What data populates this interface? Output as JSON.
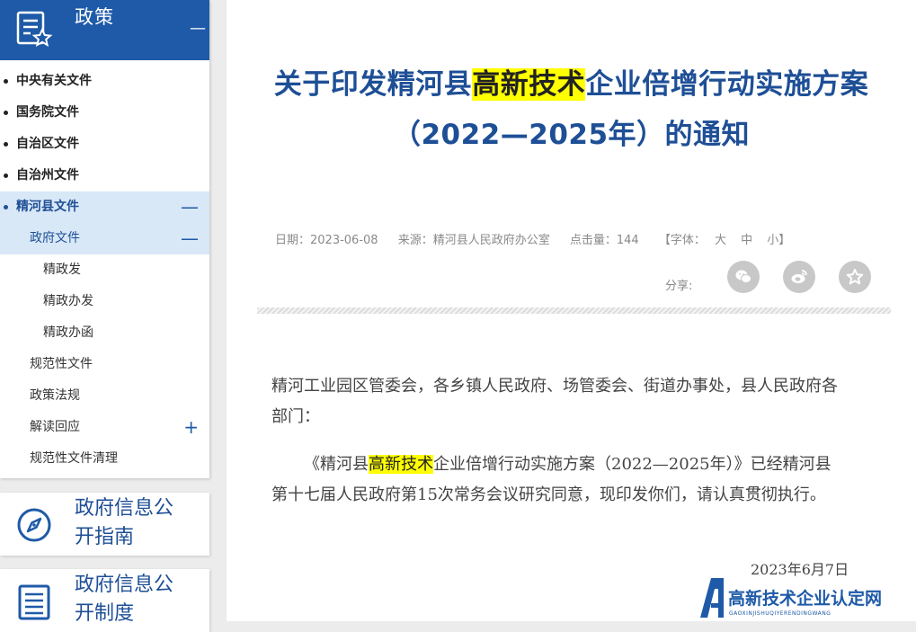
{
  "sidebar": {
    "policy_title": "政策",
    "collapse_symbol": "—",
    "menu": [
      {
        "label": "中央有关文件"
      },
      {
        "label": "国务院文件"
      },
      {
        "label": "自治区文件"
      },
      {
        "label": "自治州文件"
      },
      {
        "label": "精河县文件",
        "toggle": "—"
      },
      {
        "label": "政府文件",
        "toggle": "—"
      },
      {
        "label": "精政发"
      },
      {
        "label": "精政办发"
      },
      {
        "label": "精政办函"
      },
      {
        "label": "规范性文件"
      },
      {
        "label": "政策法规"
      },
      {
        "label": "解读回应",
        "toggle": "+"
      },
      {
        "label": "规范性文件清理"
      }
    ],
    "cards": [
      {
        "title": "政府信息公开指南"
      },
      {
        "title": "政府信息公开制度"
      }
    ]
  },
  "article": {
    "title_part1": "关于印发精河县",
    "title_highlight": "高新技术",
    "title_part2": "企业倍增行动实施方案（2022—2025年）的通知",
    "meta": {
      "date": "日期：2023-06-08",
      "source": "来源：精河县人民政府办公室",
      "clicks": "点击量：144",
      "font_open": "【字体：",
      "font_large": "大",
      "font_medium": "中",
      "font_small": "小】"
    },
    "share_label": "分享:",
    "share_icons": [
      "wechat-icon",
      "weibo-icon",
      "favorite-icon"
    ],
    "salutation": "精河工业园区管委会，各乡镇人民政府、场管委会、街道办事处，县人民政府各部门：",
    "body_part1": "《精河县",
    "body_highlight": "高新技术",
    "body_part2": "企业倍增行动实施方案（2022—2025年）》已经精河县第十七届人民政府第15次常务会议研究同意，现印发你们，请认真贯彻执行。",
    "date_line": "2023年6月7日"
  },
  "watermark": {
    "text": "高新技术企业认定网",
    "subtext": "GAOXINJISHUQIYERENDINGWANG"
  },
  "colors": {
    "brand_blue": "#1e5aa8",
    "title_blue": "#1e4f96",
    "highlight": "#ffff00",
    "active_bg": "#d9e8f7"
  }
}
